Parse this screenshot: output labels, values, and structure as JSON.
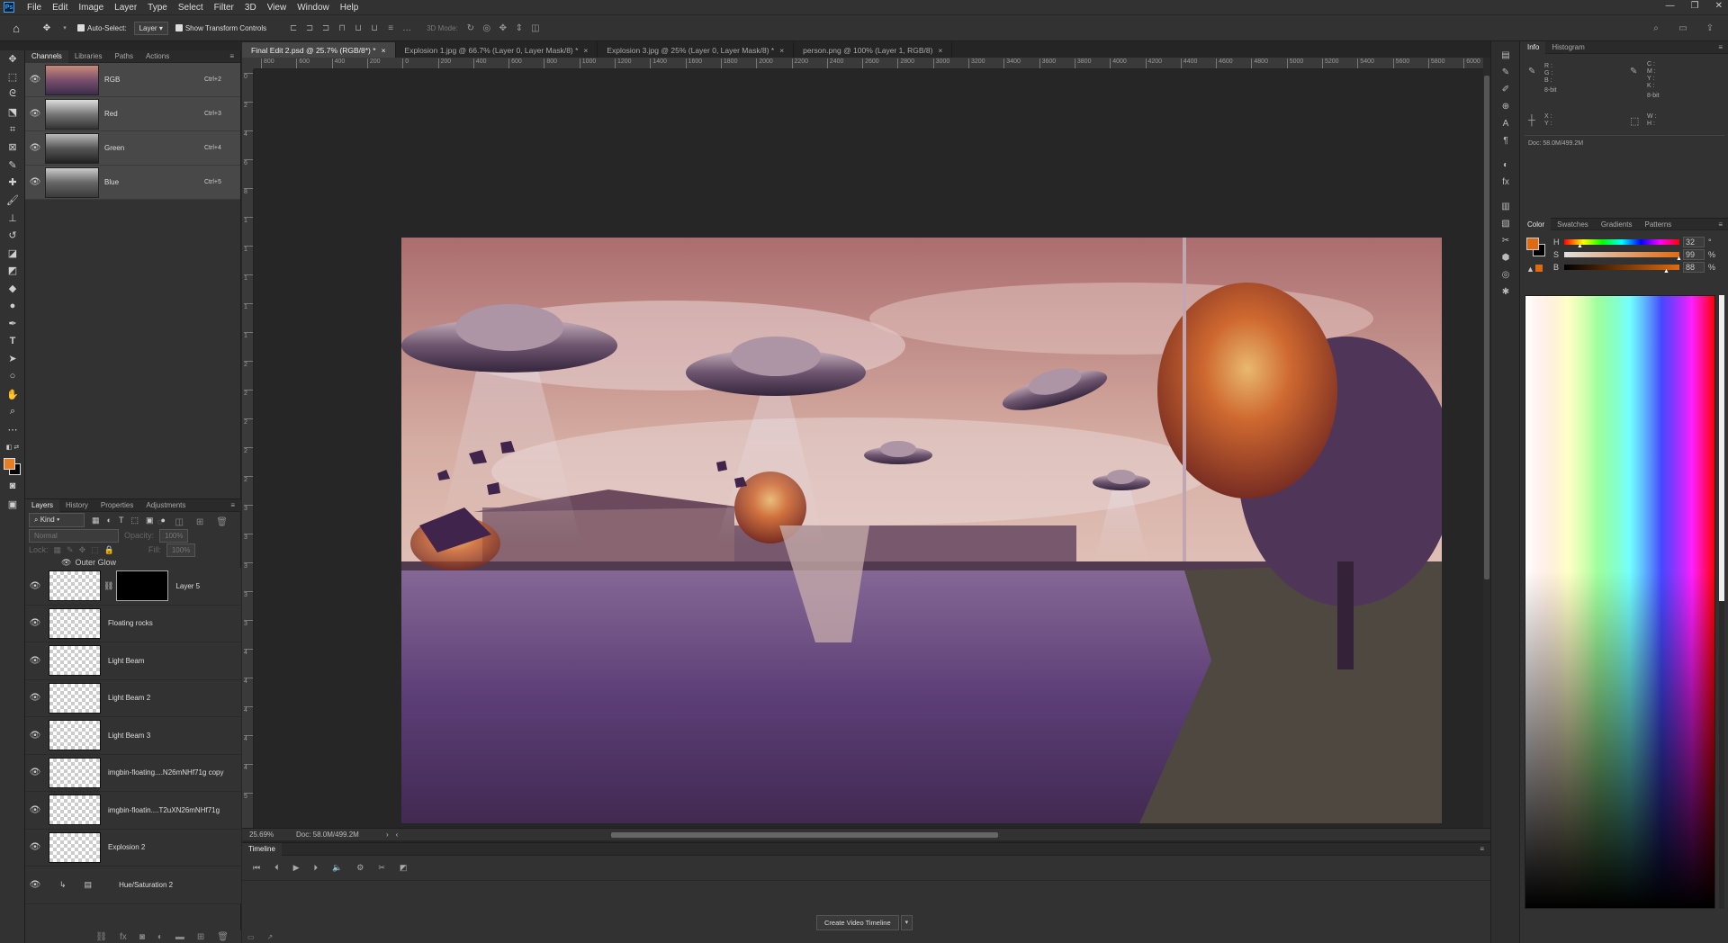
{
  "app": {
    "logo": "Ps"
  },
  "menu": [
    "File",
    "Edit",
    "Image",
    "Layer",
    "Type",
    "Select",
    "Filter",
    "3D",
    "View",
    "Window",
    "Help"
  ],
  "window_controls": [
    "—",
    "❐",
    "✕"
  ],
  "options_bar": {
    "auto_select_label": "Auto-Select:",
    "auto_select_target": "Layer",
    "show_transform_label": "Show Transform Controls",
    "mode_3d_label": "3D Mode:"
  },
  "doc_tabs": [
    {
      "label": "Final Edit 2.psd @ 25.7% (RGB/8*) *",
      "active": true
    },
    {
      "label": "Explosion 1.jpg @ 66.7% (Layer 0, Layer Mask/8) *",
      "active": false
    },
    {
      "label": "Explosion 3.jpg @ 25% (Layer 0, Layer Mask/8) *",
      "active": false
    },
    {
      "label": "person.png @ 100% (Layer 1, RGB/8)",
      "active": false
    }
  ],
  "ruler_h_ticks": [
    "800",
    "600",
    "400",
    "200",
    "0",
    "200",
    "400",
    "600",
    "800",
    "1000",
    "1200",
    "1400",
    "1600",
    "1800",
    "2000",
    "2200",
    "2400",
    "2600",
    "2800",
    "3000",
    "3200",
    "3400",
    "3600",
    "3800",
    "4000",
    "4200",
    "4400",
    "4600",
    "4800",
    "5000",
    "5200",
    "5400",
    "5600",
    "5800",
    "6000",
    "6"
  ],
  "ruler_v_ticks": [
    "0",
    "2",
    "4",
    "6",
    "8",
    "1",
    "1",
    "1",
    "1",
    "1",
    "2",
    "2",
    "2",
    "2",
    "2",
    "3",
    "3",
    "3",
    "3",
    "3",
    "4",
    "4",
    "4",
    "4",
    "4",
    "5"
  ],
  "channels_panel": {
    "tabs": [
      "Channels",
      "Libraries",
      "Paths",
      "Actions"
    ],
    "channels": [
      {
        "name": "RGB",
        "shortcut": "Ctrl+2"
      },
      {
        "name": "Red",
        "shortcut": "Ctrl+3"
      },
      {
        "name": "Green",
        "shortcut": "Ctrl+4"
      },
      {
        "name": "Blue",
        "shortcut": "Ctrl+5"
      }
    ]
  },
  "layers_panel": {
    "tabs": [
      "Layers",
      "History",
      "Properties",
      "Adjustments"
    ],
    "filter_kind": "Kind",
    "blend_mode": "Normal",
    "opacity_label": "Opacity:",
    "opacity_value": "100%",
    "lock_label": "Lock:",
    "fill_label": "Fill:",
    "fill_value": "100%",
    "effect_label": "Outer Glow",
    "layers": [
      "Layer 5",
      "Floating rocks",
      "Light Beam",
      "Light Beam 2",
      "Light Beam 3",
      "imgbin-floating....N26mNHf71g copy",
      "imgbin-floatin....T2uXN26mNHf71g",
      "Explosion 2",
      "Hue/Saturation 2"
    ]
  },
  "status_bar": {
    "zoom": "25.69%",
    "doc": "Doc: 58.0M/499.2M"
  },
  "timeline": {
    "title": "Timeline",
    "create_button": "Create Video Timeline"
  },
  "info_panel": {
    "tabs": [
      "Info",
      "Histogram"
    ],
    "rgb_labels": [
      "R :",
      "G :",
      "B :"
    ],
    "cmyk_labels": [
      "C :",
      "M :",
      "Y :",
      "K :"
    ],
    "bit_depth_left": "8-bit",
    "bit_depth_right": "8-bit",
    "xy_labels": [
      "X :",
      "Y :"
    ],
    "wh_labels": [
      "W :",
      "H :"
    ],
    "doc": "Doc: 58.0M/499.2M"
  },
  "color_panel": {
    "tabs": [
      "Color",
      "Swatches",
      "Gradients",
      "Patterns"
    ],
    "sliders": [
      {
        "label": "H",
        "value": "32",
        "unit": "°"
      },
      {
        "label": "S",
        "value": "99",
        "unit": "%"
      },
      {
        "label": "B",
        "value": "88",
        "unit": "%"
      }
    ],
    "foreground": "#e06a10",
    "background": "#000000"
  },
  "colors": {
    "accent_orange": "#e67e22",
    "panel_bg": "#323232",
    "canvas_bg": "#262626"
  }
}
